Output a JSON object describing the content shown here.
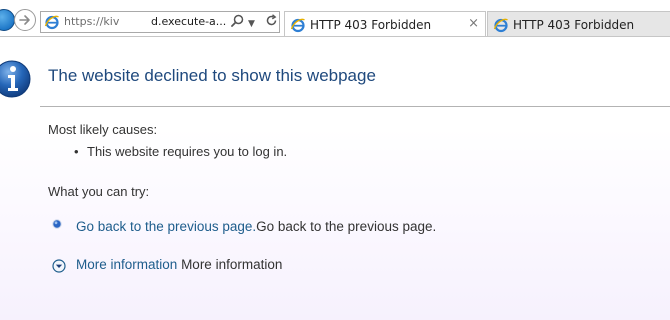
{
  "browser": {
    "address_url_prefix": "https://kiv",
    "address_url_host": "d.execute-a...",
    "tabs": [
      {
        "label": "HTTP 403 Forbidden",
        "close": "×"
      },
      {
        "label": "HTTP 403 Forbidden"
      }
    ]
  },
  "page": {
    "title": "The website declined to show this webpage",
    "causes_heading": "Most likely causes:",
    "causes": [
      "This website requires you to log in."
    ],
    "try_heading": "What you can try:",
    "actions": {
      "go_back_link": "Go back to the previous page.",
      "go_back_text": "Go back to the previous page.",
      "more_info_link": "More information",
      "more_info_text": "More information"
    }
  },
  "colors": {
    "link": "#1e5d8c",
    "title": "#1f497d",
    "info_icon": "#1f5fb0"
  },
  "icons": {
    "back": "back-arrow-icon",
    "forward": "forward-arrow-icon",
    "search": "search-icon",
    "refresh": "refresh-icon",
    "ie": "internet-explorer-icon",
    "info": "info-icon",
    "expand": "chevron-down-circle-icon"
  }
}
